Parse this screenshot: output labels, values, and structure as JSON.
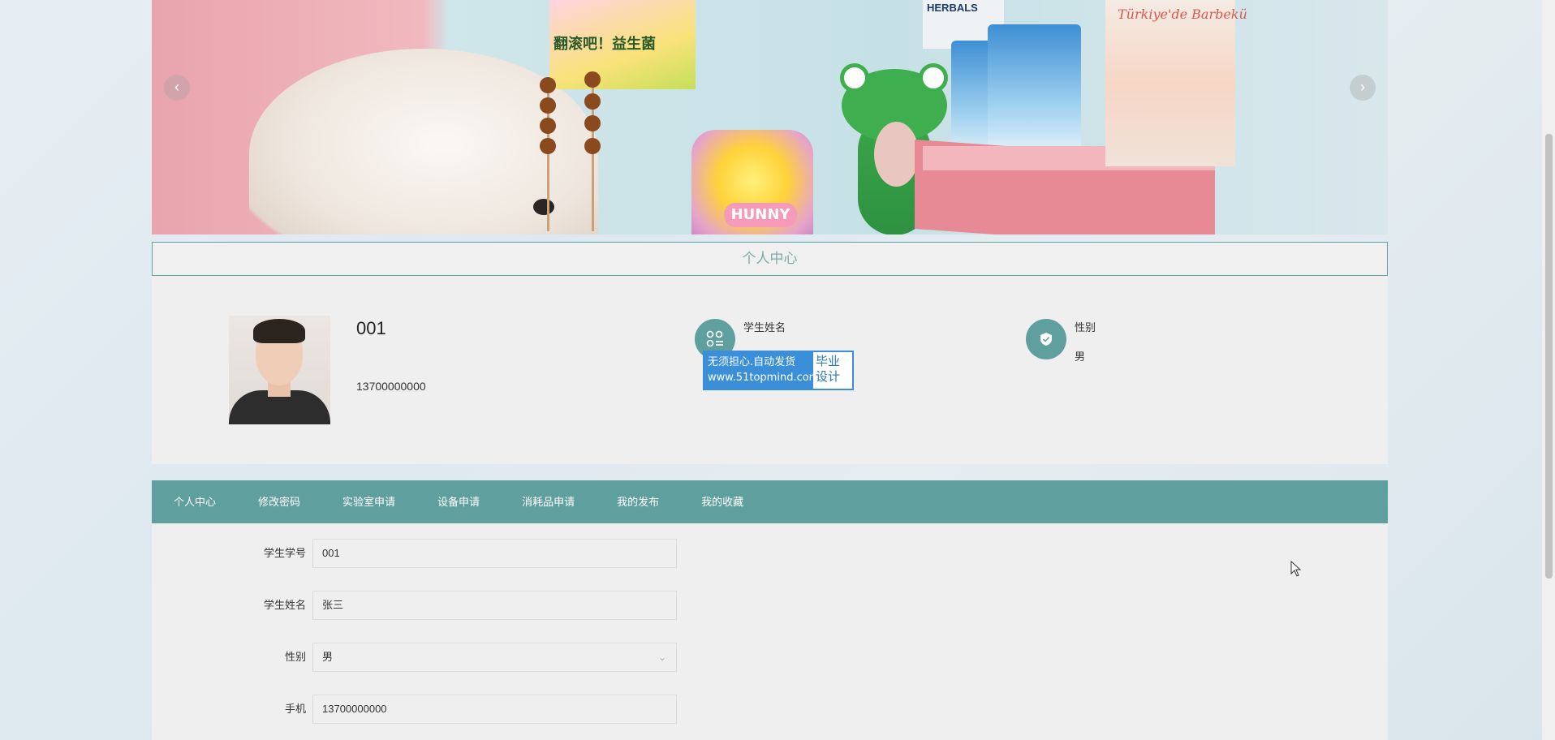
{
  "banner": {
    "prev_icon": "chevron-left-icon",
    "next_icon": "chevron-right-icon",
    "prev_glyph": "‹",
    "next_glyph": "›",
    "poster_text": "翻滚吧！益生菌",
    "honey_label": "HUNNY",
    "herbals_text": "HERBALS",
    "tall_bag_text": "Türkiye'de Barbekü"
  },
  "section": {
    "title": "个人中心"
  },
  "profile": {
    "student_id": "001",
    "phone": "13700000000",
    "name_label": "学生姓名",
    "name_value": "",
    "gender_label": "性别",
    "gender_value": "男",
    "name_icon": "grid-icon",
    "gender_icon": "shield-icon"
  },
  "watermark": {
    "line1": "无须担心.自动发货",
    "line2": "www.51topmind.com",
    "right1": "毕业",
    "right2": "设计"
  },
  "tabs": [
    {
      "label": "个人中心"
    },
    {
      "label": "修改密码"
    },
    {
      "label": "实验室申请"
    },
    {
      "label": "设备申请"
    },
    {
      "label": "消耗品申请"
    },
    {
      "label": "我的发布"
    },
    {
      "label": "我的收藏"
    }
  ],
  "form": {
    "student_id_label": "学生学号",
    "student_id_value": "001",
    "name_label": "学生姓名",
    "name_value": "张三",
    "gender_label": "性别",
    "gender_value": "男",
    "phone_label": "手机",
    "phone_value": "13700000000"
  },
  "colors": {
    "accent": "#5fa09e",
    "section_border": "#5ea3a1"
  }
}
